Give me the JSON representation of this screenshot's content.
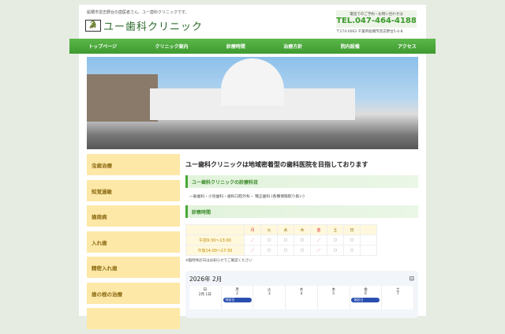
{
  "header": {
    "tagline": "船橋市習志野台の歯医者さん、ユー歯科クリニックです。",
    "logo_text": "ユー歯科クリニック",
    "contact_label": "電話でのご予約・お問い合わせは",
    "phone": "TEL.047-464-4188",
    "address": "〒274-0063 千葉県船橋市習志野台5-4-8"
  },
  "nav": [
    "トップページ",
    "クリニック案内",
    "診療時間",
    "治療方針",
    "院内設備",
    "アクセス"
  ],
  "sidebar": [
    "虫歯治療",
    "知覚過敏",
    "歯周病",
    "入れ歯",
    "精密入れ歯",
    "歯の根の治療"
  ],
  "main": {
    "title": "ユー歯科クリニックは地域密着型の歯科医院を目指しております",
    "sec1": "ユー歯科クリニックの診療科目",
    "sec1_text": "一般歯科・小児歯科・歯科口腔外科・ 矯正歯科 (各種保険取り扱い)",
    "sec2": "診察時間",
    "days": [
      "月",
      "火",
      "水",
      "木",
      "金",
      "土",
      "日"
    ],
    "rows": [
      {
        "label": "午前9:30～13:00",
        "cells": [
          "／",
          "○",
          "○",
          "○",
          "／",
          "○",
          "○"
        ]
      },
      {
        "label": "午後14:00～17:30",
        "cells": [
          "／",
          "○",
          "○",
          "○",
          "／",
          "○",
          "○"
        ]
      }
    ],
    "note": "※臨時休診日はお知らせでご確認ください"
  },
  "calendar": {
    "title": "2026年 2月",
    "days": [
      {
        "w": "日",
        "d": "2月 1日"
      },
      {
        "w": "月",
        "d": "2",
        "ev": "休診日"
      },
      {
        "w": "火",
        "d": "3"
      },
      {
        "w": "水",
        "d": "4"
      },
      {
        "w": "木",
        "d": "5"
      },
      {
        "w": "金",
        "d": "6",
        "ev": "休診日"
      },
      {
        "w": "土",
        "d": "7"
      }
    ]
  }
}
